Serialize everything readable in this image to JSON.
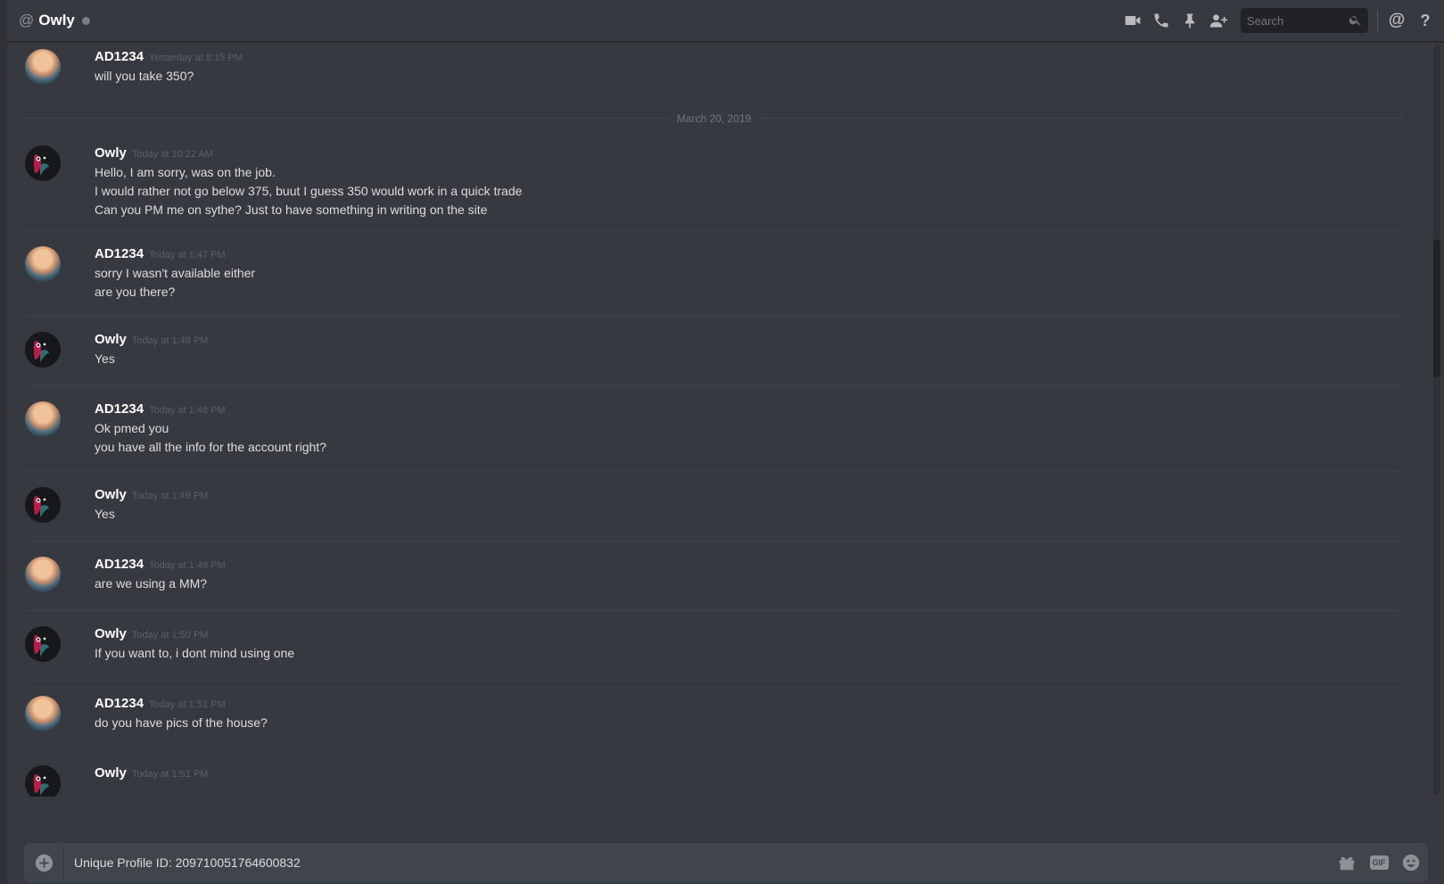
{
  "header": {
    "at_symbol": "@",
    "channel_name": "Owly",
    "search_placeholder": "Search",
    "icons": [
      "video-icon",
      "phone-icon",
      "pin-icon",
      "add-friend-icon",
      "search-icon",
      "mention-icon",
      "help-icon"
    ],
    "mention_label": "@",
    "help_label": "?"
  },
  "date_divider": "March 20, 2019",
  "messages": [
    {
      "author": "AD1234",
      "timestamp": "Yesterday at 8:15 PM",
      "lines": [
        "will you take 350?"
      ]
    },
    {
      "author": "Owly",
      "timestamp": "Today at 10:22 AM",
      "lines": [
        "Hello, I am sorry, was on the job.",
        "I would rather not go below 375, buut I guess 350 would work in a quick trade",
        "Can you PM me on sythe? Just to have something in writing on the site"
      ]
    },
    {
      "author": "AD1234",
      "timestamp": "Today at 1:47 PM",
      "lines": [
        "sorry I wasn't available either",
        "are you there?"
      ]
    },
    {
      "author": "Owly",
      "timestamp": "Today at 1:48 PM",
      "lines": [
        "Yes"
      ]
    },
    {
      "author": "AD1234",
      "timestamp": "Today at 1:48 PM",
      "lines": [
        "Ok pmed you",
        "you have all the info for the account right?"
      ]
    },
    {
      "author": "Owly",
      "timestamp": "Today at 1:49 PM",
      "lines": [
        "Yes"
      ]
    },
    {
      "author": "AD1234",
      "timestamp": "Today at 1:49 PM",
      "lines": [
        "are we using a MM?"
      ]
    },
    {
      "author": "Owly",
      "timestamp": "Today at 1:50 PM",
      "lines": [
        "If you want to, i dont mind using one"
      ]
    },
    {
      "author": "AD1234",
      "timestamp": "Today at 1:51 PM",
      "lines": [
        "do you have pics of the house?"
      ]
    },
    {
      "author": "Owly",
      "timestamp": "Today at 1:51 PM",
      "lines": []
    }
  ],
  "composer": {
    "value": "Unique Profile ID: 209710051764600832",
    "gif_label": "GIF",
    "icons": [
      "upload-plus-icon",
      "gift-icon",
      "gif-icon",
      "emoji-icon"
    ]
  },
  "colors": {
    "background": "#36393f",
    "header_text": "#ffffff",
    "timestamp": "#5c6067",
    "input_bg": "#40444b"
  }
}
